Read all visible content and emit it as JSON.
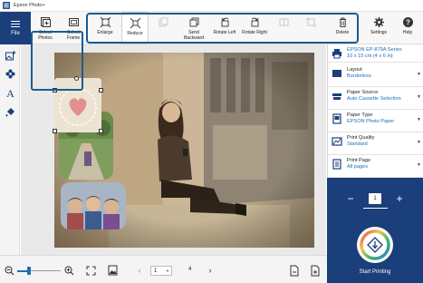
{
  "titlebar": {
    "title": "Epson Photo+"
  },
  "toolbar": {
    "file": "File",
    "select_photos": "Select Photos",
    "select_frame": "Select Frame",
    "enlarge": "Enlarge",
    "reduce": "Reduce",
    "send_backward": "Send Backward",
    "rotate_left": "Rotate Left",
    "rotate_right": "Rotate Right",
    "delete": "Delete",
    "settings": "Settings",
    "help": "Help"
  },
  "right_panel": {
    "printer": {
      "line1": "EPSON EP-879A Series",
      "line2": "10 x 15 cm (4 x 6 in)"
    },
    "layout": {
      "label": "Layout",
      "value": "Borderless"
    },
    "paper_source": {
      "label": "Paper Source",
      "value": "Auto Cassette Selection"
    },
    "paper_type": {
      "label": "Paper Type",
      "value": "EPSON Photo Paper"
    },
    "print_quality": {
      "label": "Print Quality",
      "value": "Standard"
    },
    "print_page": {
      "label": "Print Page",
      "value": "All pages"
    },
    "quantity": "1",
    "start_printing": "Start Printing"
  },
  "bottom_bar": {
    "current_page": "1",
    "total_pages": "4",
    "zoom_level": 0.28
  },
  "colors": {
    "accent": "#1b5c8f",
    "file_button": "#1b3f7a",
    "print_panel": "#1b3f7a",
    "link_text": "#1b6fb8"
  }
}
